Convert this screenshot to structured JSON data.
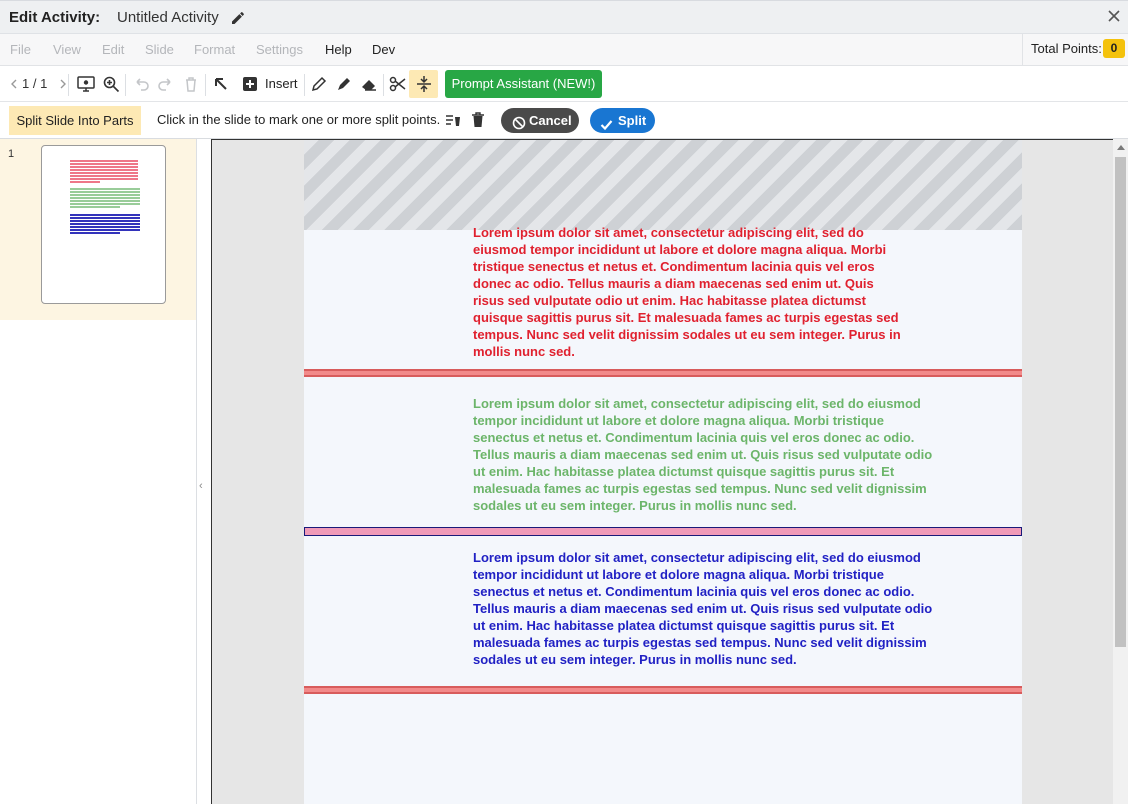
{
  "title": {
    "label": "Edit Activity:",
    "activity_name": "Untitled Activity"
  },
  "menu": {
    "items": [
      {
        "label": "File",
        "enabled": false
      },
      {
        "label": "View",
        "enabled": false
      },
      {
        "label": "Edit",
        "enabled": false
      },
      {
        "label": "Slide",
        "enabled": false
      },
      {
        "label": "Format",
        "enabled": false
      },
      {
        "label": "Settings",
        "enabled": false
      },
      {
        "label": "Help",
        "enabled": true
      },
      {
        "label": "Dev",
        "enabled": true
      }
    ],
    "total_points_label": "Total Points:",
    "total_points_value": "0"
  },
  "toolbar": {
    "pager": "1 / 1",
    "insert_label": "Insert",
    "prompt_assistant_label": "Prompt Assistant (NEW!)",
    "icons": [
      "chevron-left-icon",
      "chevron-right-icon",
      "preview-icon",
      "zoom-icon",
      "undo-icon",
      "redo-icon",
      "trash-icon",
      "select-arrow-icon",
      "insert-plus-icon",
      "pencil-icon",
      "marker-icon",
      "eraser-icon",
      "scissors-icon",
      "split-lines-icon"
    ]
  },
  "splitbar": {
    "mode_label": "Split Slide Into Parts",
    "instruction": "Click in the slide to mark one or more split points.",
    "cancel_label": "Cancel",
    "split_label": "Split"
  },
  "sidebar": {
    "slides": [
      {
        "number": "1"
      }
    ]
  },
  "slide": {
    "paragraphs": [
      {
        "text": "Lorem ipsum dolor sit amet, consectetur adipiscing elit, sed do eiusmod tempor incididunt ut labore et dolore magna aliqua. Morbi tristique senectus et netus et. Condimentum lacinia quis vel eros donec ac odio. Tellus mauris a diam maecenas sed enim ut. Quis risus sed vulputate odio ut enim. Hac habitasse platea dictumst quisque sagittis purus sit. Et malesuada fames ac turpis egestas sed tempus. Nunc sed velit dignissim sodales ut eu sem integer. Purus in mollis nunc sed.",
        "color": "#e0212f"
      },
      {
        "text": "Lorem ipsum dolor sit amet, consectetur adipiscing elit, sed do eiusmod tempor incididunt ut labore et dolore magna aliqua. Morbi tristique senectus et netus et. Condimentum lacinia quis vel eros donec ac odio. Tellus mauris a diam maecenas sed enim ut. Quis risus sed vulputate odio ut enim. Hac habitasse platea dictumst quisque sagittis purus sit. Et malesuada fames ac turpis egestas sed tempus. Nunc sed velit dignissim sodales ut eu sem integer. Purus in mollis nunc sed.",
        "color": "#6cb56a"
      },
      {
        "text": "Lorem ipsum dolor sit amet, consectetur adipiscing elit, sed do eiusmod tempor incididunt ut labore et dolore magna aliqua. Morbi tristique senectus et netus et. Condimentum lacinia quis vel eros donec ac odio. Tellus mauris a diam maecenas sed enim ut. Quis risus sed vulputate odio ut enim. Hac habitasse platea dictumst quisque sagittis purus sit. Et malesuada fames ac turpis egestas sed tempus. Nunc sed velit dignissim sodales ut eu sem integer. Purus in mollis nunc sed.",
        "color": "#2121c4"
      }
    ]
  },
  "colors": {
    "accent_green": "#28a745",
    "accent_blue": "#1976d2",
    "highlight": "#fde9b4",
    "badge": "#f4c20d"
  }
}
